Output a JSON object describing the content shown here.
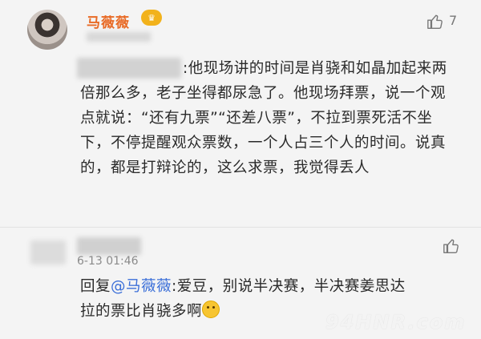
{
  "comment1": {
    "username": "马薇薇",
    "like_count": "7",
    "text_part": ":他现场讲的时间是肖骁和如晶加起来两倍那么多，老子坐得都尿急了。他现场拜票，说一个观点就说：“还有九票”“还差八票”，不拉到票死活不坐下，不停提醒观众票数，一个人占三个人的时间。说真的，都是打辩论的，这么求票，我觉得丢人"
  },
  "comment2": {
    "date": "6-13 01:46",
    "reply_prefix": "回复",
    "mention": "@马薇薇",
    "reply_text": ":爱豆，别说半决赛，半决赛姜思达拉的票比肖骁多啊"
  },
  "icons": {
    "like": "thumbs-up-icon",
    "vip": "crown-badge-icon",
    "emoji": "smile-emoji-icon"
  },
  "colors": {
    "username": "#e86a25",
    "mention": "#3b6fd8",
    "background": "#f4f4f4"
  },
  "watermark": "94HNR.com"
}
